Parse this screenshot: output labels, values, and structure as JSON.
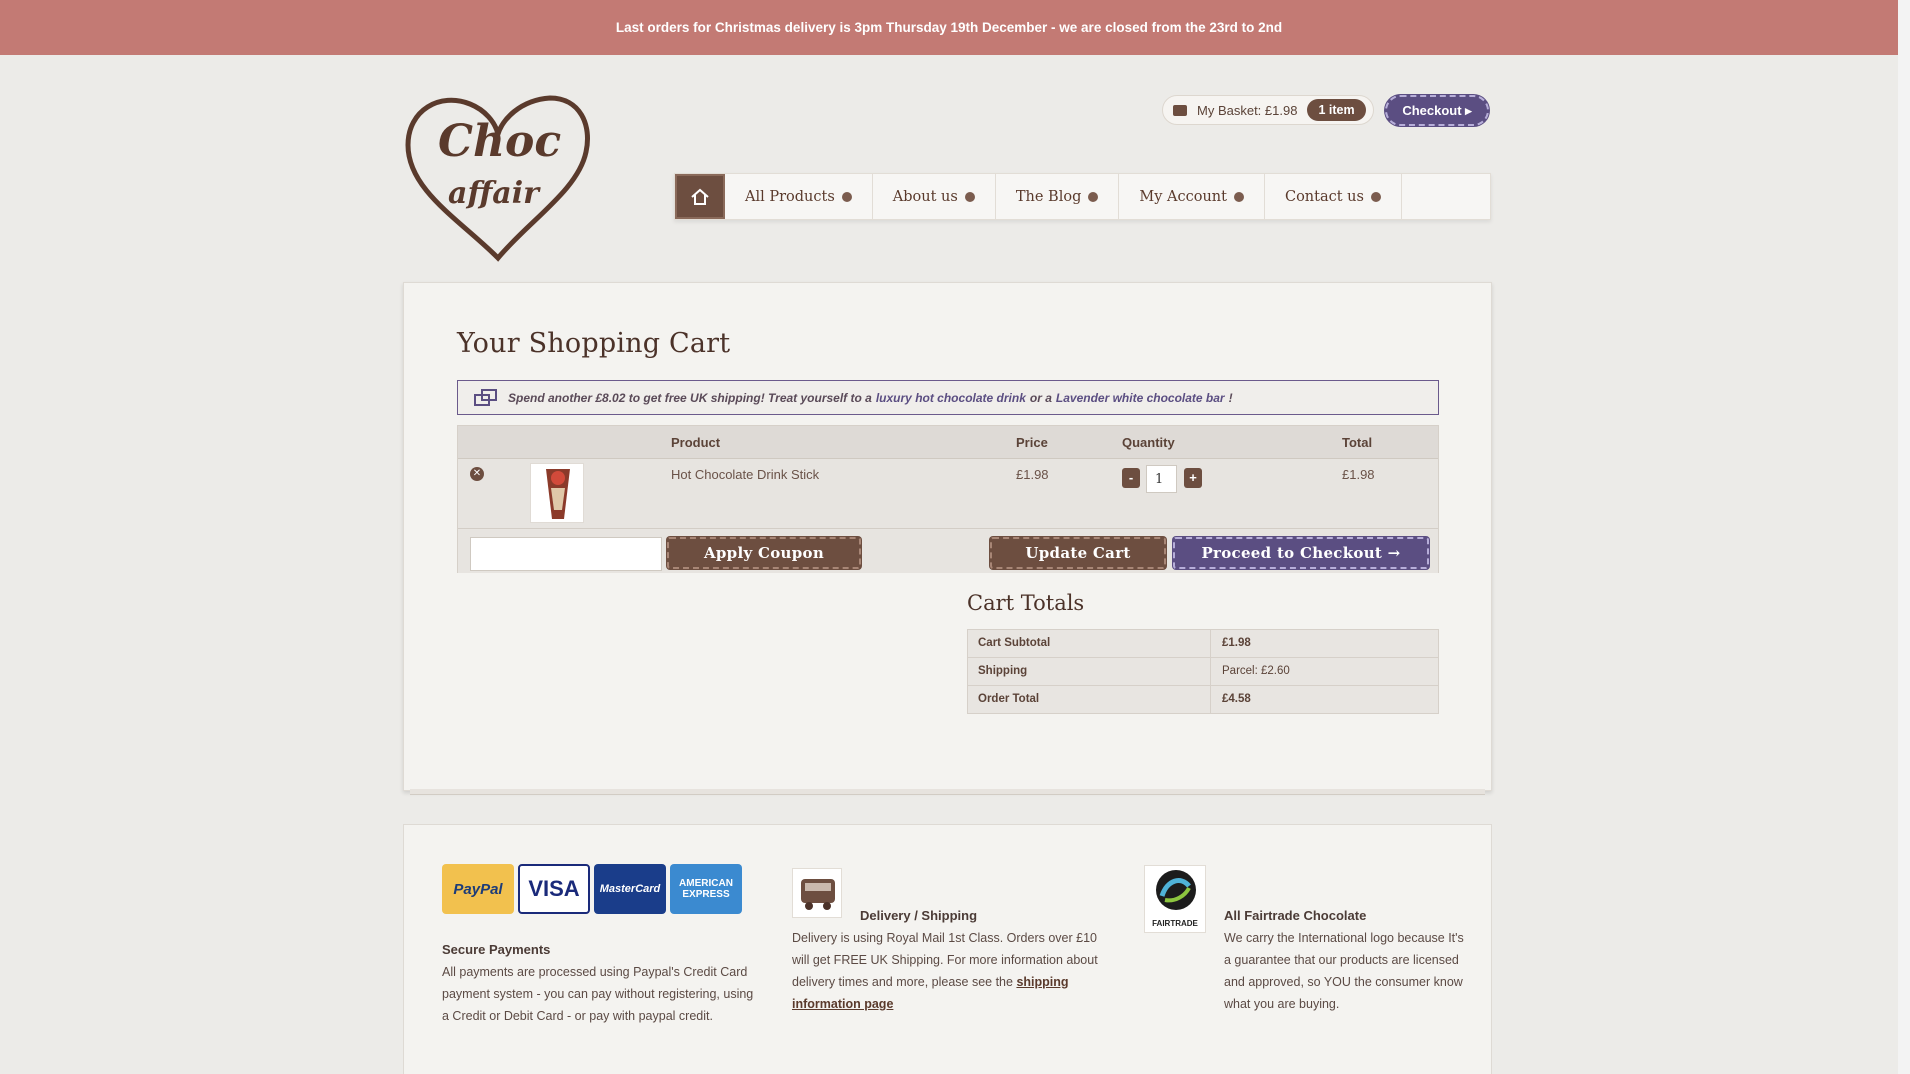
{
  "banner": {
    "text": "Last orders for Christmas delivery is 3pm Thursday 19th December - we are closed from the 23rd to 2nd"
  },
  "logo": {
    "line1": "Choc",
    "line2": "affair"
  },
  "basket": {
    "label": "My Basket: £1.98",
    "count": "1 item",
    "checkout": "Checkout ▸"
  },
  "nav": {
    "items": [
      {
        "label": "All Products"
      },
      {
        "label": "About us"
      },
      {
        "label": "The Blog"
      },
      {
        "label": "My Account"
      },
      {
        "label": "Contact us"
      }
    ]
  },
  "cart": {
    "title": "Your Shopping Cart",
    "notice": {
      "prefix": "Spend another £8.02 to get free UK shipping! Treat yourself to a",
      "link1": "luxury hot chocolate drink",
      "middle": "or a",
      "link2": "Lavender white chocolate bar",
      "suffix": "!"
    },
    "columns": {
      "product": "Product",
      "price": "Price",
      "quantity": "Quantity",
      "total": "Total"
    },
    "row": {
      "product": "Hot Chocolate Drink Stick",
      "price": "£1.98",
      "quantity": "1",
      "total": "£1.98",
      "minus": "-",
      "plus": "+"
    },
    "buttons": {
      "apply_coupon": "Apply Coupon",
      "update_cart": "Update Cart",
      "proceed": "Proceed to Checkout →"
    }
  },
  "totals": {
    "title": "Cart Totals",
    "rows": [
      {
        "label": "Cart Subtotal",
        "value": "£1.98"
      },
      {
        "label": "Shipping",
        "value": "Parcel: £2.60"
      },
      {
        "label": "Order Total",
        "value": "£4.58"
      }
    ]
  },
  "footer": {
    "payments": {
      "cards": [
        "PayPal",
        "VISA",
        "MasterCard",
        "AMERICAN EXPRESS"
      ],
      "heading": "Secure Payments",
      "text": "All payments are processed using Paypal's Credit Card payment system - you can pay without registering, using a Credit or Debit Card - or pay with paypal credit."
    },
    "delivery": {
      "heading": "Delivery / Shipping",
      "text": "Delivery is using Royal Mail 1st Class. Orders over £10 will get FREE UK Shipping. For more information about delivery times and more, please see the",
      "link": "shipping information page"
    },
    "fairtrade": {
      "heading": "All Fairtrade Chocolate",
      "text": "We carry the International logo because It's a guarantee that our products are licensed and approved, so YOU the consumer know what you are buying.",
      "badge": "FAIRTRADE"
    }
  },
  "colors": {
    "banner": "#c37a74",
    "brown": "#6d4e40",
    "purple": "#5b4e82",
    "background": "#ecebe8"
  }
}
